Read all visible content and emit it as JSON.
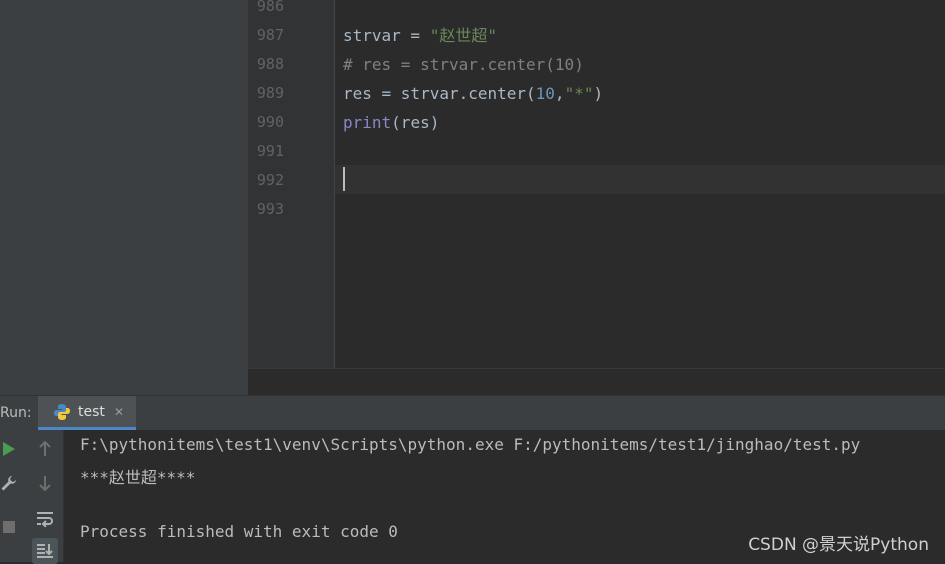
{
  "editor": {
    "line_numbers": [
      "986",
      "987",
      "988",
      "989",
      "990",
      "991",
      "992",
      "993"
    ],
    "lines": {
      "l987": {
        "var": "strvar",
        "op": " = ",
        "str": "\"赵世超\""
      },
      "l988": {
        "comment": "# res = strvar.center(10)"
      },
      "l989": {
        "pre": "res = strvar.center(",
        "num": "10",
        "comma": ",",
        "str": "\"*\"",
        "close": ")"
      },
      "l990": {
        "func": "print",
        "rest": "(res)"
      }
    }
  },
  "run_panel": {
    "label": "Run:",
    "tab_label": "test",
    "tab_close": "✕",
    "output": [
      "F:\\pythonitems\\test1\\venv\\Scripts\\python.exe F:/pythonitems/test1/jinghao/test.py",
      "***赵世超****",
      "",
      "Process finished with exit code 0"
    ]
  },
  "watermark": "CSDN @景天说Python",
  "colors": {
    "editor_bg": "#2b2b2b",
    "string": "#6a8759",
    "comment": "#808080",
    "number": "#6897bb",
    "builtin": "#8888c6",
    "run_green": "#499c54"
  }
}
